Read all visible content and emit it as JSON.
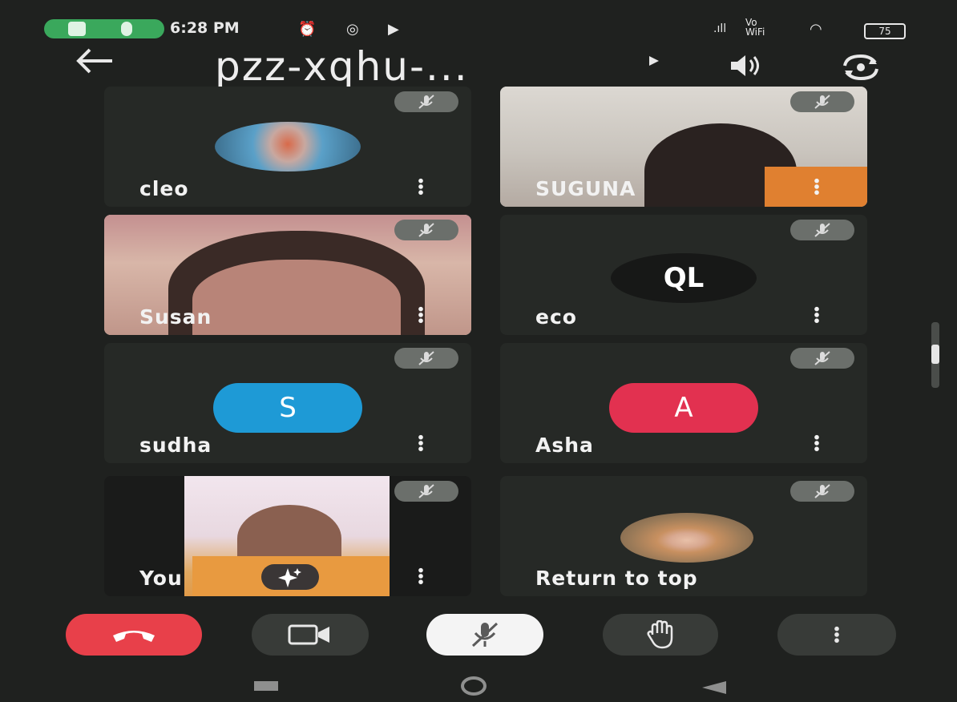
{
  "status_bar": {
    "time": "6:28 PM",
    "signal_label": "Vo WiFi",
    "battery": "75"
  },
  "header": {
    "title": "pzz-xqhu-...",
    "back_icon": "arrow-left-icon",
    "play_icon": "play-icon",
    "speaker_icon": "speaker-icon",
    "switch_camera_icon": "switch-camera-icon"
  },
  "participants": [
    {
      "name": "cleo",
      "type": "photo-avatar",
      "muted": true
    },
    {
      "name": "SUGUNA",
      "type": "video",
      "muted": true
    },
    {
      "name": "Susan",
      "type": "video",
      "muted": true
    },
    {
      "name": "eco",
      "type": "logo-avatar",
      "logo_text": "QL",
      "muted": true
    },
    {
      "name": "sudha",
      "type": "letter-avatar",
      "letter": "S",
      "color": "#1e9ad6",
      "muted": true
    },
    {
      "name": "Asha",
      "type": "letter-avatar",
      "letter": "A",
      "color": "#e23150",
      "muted": true
    },
    {
      "name": "You",
      "type": "video",
      "muted": true,
      "effects_icon": "sparkle-icon"
    },
    {
      "name": "Return to top",
      "type": "photo-avatar",
      "muted": true
    }
  ],
  "controls": [
    {
      "name": "end-call",
      "icon": "phone-hangup-icon",
      "color": "#e8404a"
    },
    {
      "name": "camera",
      "icon": "video-camera-icon"
    },
    {
      "name": "microphone",
      "icon": "mic-off-icon",
      "color": "#f4f4f4"
    },
    {
      "name": "raise-hand",
      "icon": "hand-icon"
    },
    {
      "name": "more-options",
      "icon": "more-vertical-icon"
    }
  ],
  "colors": {
    "background": "#1f211f",
    "tile": "#262926",
    "mute_chip": "#6b6f6b",
    "accent_green": "#3aa85c"
  }
}
